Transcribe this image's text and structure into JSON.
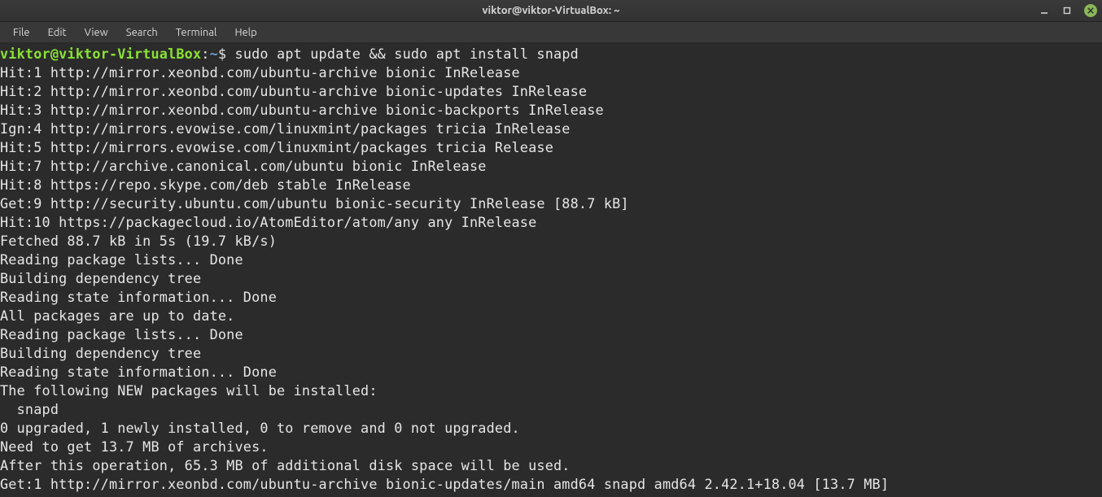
{
  "window": {
    "title": "viktor@viktor-VirtualBox: ~"
  },
  "menu": {
    "file": "File",
    "edit": "Edit",
    "view": "View",
    "search": "Search",
    "terminal": "Terminal",
    "help": "Help"
  },
  "prompt": {
    "userhost": "viktor@viktor-VirtualBox",
    "sep": ":",
    "path": "~",
    "sigil": "$ "
  },
  "command": "sudo apt update && sudo apt install snapd",
  "output": [
    "Hit:1 http://mirror.xeonbd.com/ubuntu-archive bionic InRelease",
    "Hit:2 http://mirror.xeonbd.com/ubuntu-archive bionic-updates InRelease",
    "Hit:3 http://mirror.xeonbd.com/ubuntu-archive bionic-backports InRelease",
    "Ign:4 http://mirrors.evowise.com/linuxmint/packages tricia InRelease",
    "Hit:5 http://mirrors.evowise.com/linuxmint/packages tricia Release",
    "Hit:7 http://archive.canonical.com/ubuntu bionic InRelease",
    "Hit:8 https://repo.skype.com/deb stable InRelease",
    "Get:9 http://security.ubuntu.com/ubuntu bionic-security InRelease [88.7 kB]",
    "Hit:10 https://packagecloud.io/AtomEditor/atom/any any InRelease",
    "Fetched 88.7 kB in 5s (19.7 kB/s)",
    "Reading package lists... Done",
    "Building dependency tree",
    "Reading state information... Done",
    "All packages are up to date.",
    "Reading package lists... Done",
    "Building dependency tree",
    "Reading state information... Done",
    "The following NEW packages will be installed:",
    "  snapd",
    "0 upgraded, 1 newly installed, 0 to remove and 0 not upgraded.",
    "Need to get 13.7 MB of archives.",
    "After this operation, 65.3 MB of additional disk space will be used.",
    "Get:1 http://mirror.xeonbd.com/ubuntu-archive bionic-updates/main amd64 snapd amd64 2.42.1+18.04 [13.7 MB]"
  ]
}
